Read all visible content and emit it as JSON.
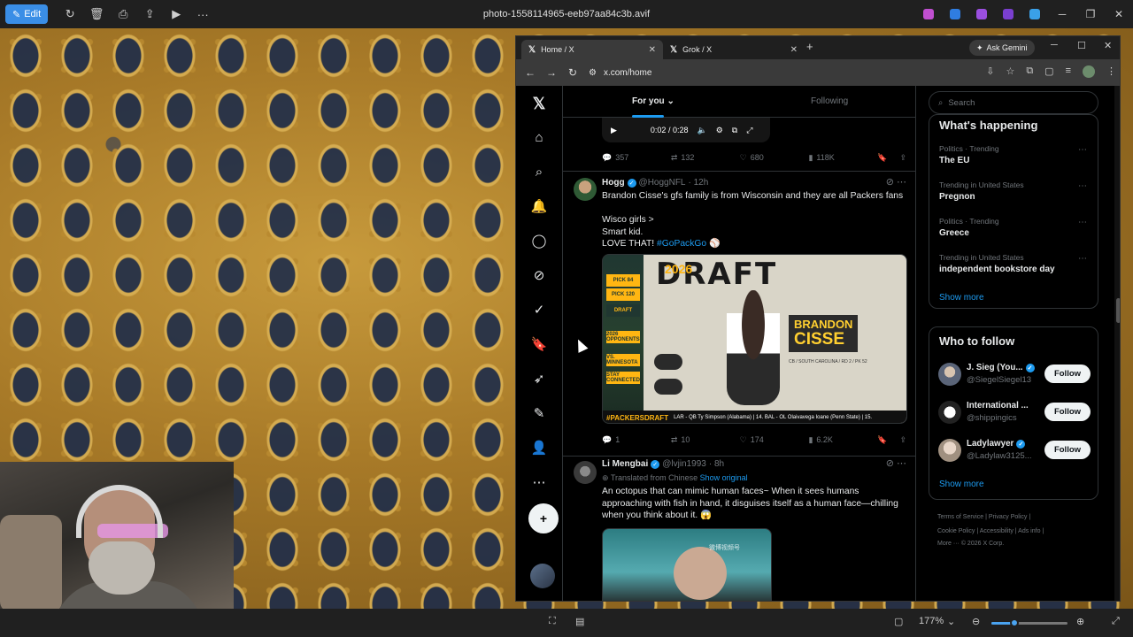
{
  "viewer": {
    "edit_label": "Edit",
    "title": "photo-1558114965-eeb97aa84c3b.avif",
    "zoom_level": "177%",
    "zoom_fraction": 0.3
  },
  "browser": {
    "tabs": [
      {
        "label": "Home / X",
        "active": true
      },
      {
        "label": "Grok / X",
        "active": false
      }
    ],
    "gemini_label": "Ask Gemini",
    "url": "x.com/home"
  },
  "feed": {
    "tab_for_you": "For you",
    "tab_following": "Following",
    "video_time": "0:02 / 0:28",
    "top_actions": {
      "replies": "357",
      "reposts": "132",
      "likes": "680",
      "views": "118K"
    },
    "tweets": [
      {
        "name": "Hogg",
        "handle": "@HoggNFL",
        "time": "· 12h",
        "text_lines": [
          "Brandon Cisse's gfs family is from Wisconsin and they are all Packers fans",
          "",
          "Wisco girls >",
          "Smart kid.",
          "LOVE THAT! "
        ],
        "hashtag": "#GoPackGo",
        "media": {
          "title": "DRAFT",
          "year": "2026",
          "player_first": "BRANDON",
          "player_last": "CISSE",
          "player_sub": "CB / SOUTH CAROLINA / RD 2 / PK 52",
          "side_items": [
            "PICK 84",
            "PICK 120",
            "DRAFT",
            "2026 OPPONENTS",
            "VS. MINNESOTA",
            "STAY CONNECTED"
          ],
          "ticker_tag": "#PACKERSDRAFT",
          "ticker_text": "LAR - QB Ty Simpson (Alabama) | 14. BAL - OL Olaivavega Ioane (Penn State) | 15."
        },
        "actions": {
          "replies": "1",
          "reposts": "10",
          "likes": "174",
          "views": "6.2K"
        }
      },
      {
        "name": "Li Mengbai",
        "handle": "@lvjin1993",
        "time": "· 8h",
        "translated": "Translated from Chinese",
        "show_original": "Show original",
        "text_lines": [
          "An octopus that can mimic human faces~ When it sees humans",
          "approaching with fish in hand, it disguises itself as a human face—chilling",
          "when you think about it. 😱"
        ],
        "media_watermark": "微博视频号"
      }
    ]
  },
  "sidebar": {
    "search_placeholder": "Search",
    "whats_happening_title": "What's happening",
    "trends": [
      {
        "category": "Politics · Trending",
        "name": "The EU"
      },
      {
        "category": "Trending in United States",
        "name": "Pregnon"
      },
      {
        "category": "Politics · Trending",
        "name": "Greece"
      },
      {
        "category": "Trending in United States",
        "name": "independent bookstore day"
      }
    ],
    "show_more": "Show more",
    "who_to_follow_title": "Who to follow",
    "follow_suggestions": [
      {
        "name": "J. Sieg (You...",
        "handle": "@SiegelSiegel13",
        "verified": true
      },
      {
        "name": "International ...",
        "handle": "@shippingics",
        "verified": false
      },
      {
        "name": "Ladylawyer",
        "handle": "@Ladylaw3125...",
        "verified": true
      }
    ],
    "follow_label": "Follow",
    "footer_line1": "Terms of Service  |  Privacy Policy  |",
    "footer_line2": "Cookie Policy  |  Accessibility  |  Ads info  |",
    "footer_line3": "More ···  © 2026 X Corp."
  },
  "colors": {
    "accent": "#1d9bf0",
    "background": "#000000",
    "edit_button": "#3a8ee6"
  }
}
